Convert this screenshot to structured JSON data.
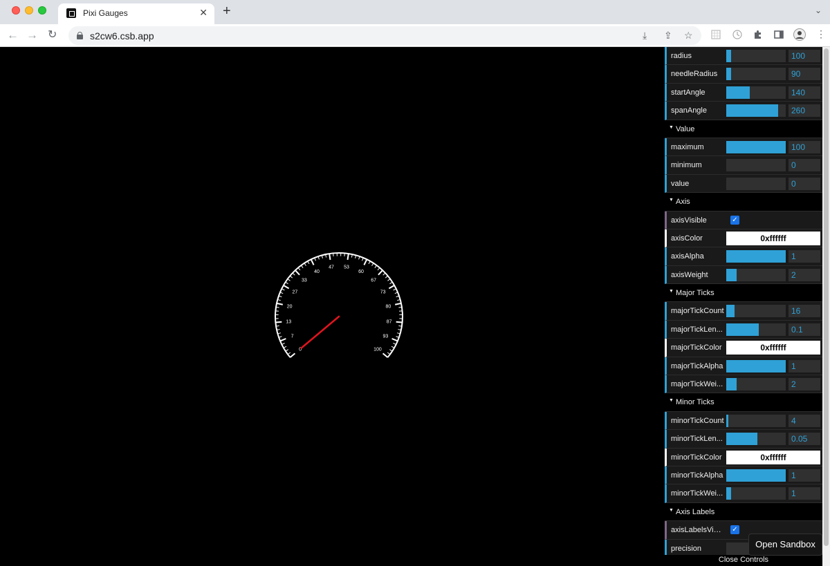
{
  "browser": {
    "tab_title": "Pixi Gauges",
    "new_tab": "+",
    "tab_close": "✕",
    "url": "s2cw6.csb.app"
  },
  "gauge": {
    "tick_labels": [
      "0",
      "7",
      "13",
      "20",
      "27",
      "33",
      "40",
      "47",
      "53",
      "60",
      "67",
      "73",
      "80",
      "87",
      "93",
      "100"
    ],
    "value": 0,
    "min": 0,
    "max": 100,
    "start_angle": 140,
    "span_angle": 260,
    "major_tick_count": 16,
    "minor_tick_count": 4,
    "axis_color": "#ffffff",
    "needle_color": "#e0141e"
  },
  "gui": {
    "top_rows": [
      {
        "label": "radius",
        "value": "100",
        "fill": 0.08
      },
      {
        "label": "needleRadius",
        "value": "90",
        "fill": 0.08
      },
      {
        "label": "startAngle",
        "value": "140",
        "fill": 0.39
      },
      {
        "label": "spanAngle",
        "value": "260",
        "fill": 0.87
      }
    ],
    "folders": {
      "value": {
        "title": "Value",
        "rows": [
          {
            "label": "maximum",
            "value": "100",
            "fill": 1.0
          },
          {
            "label": "minimum",
            "value": "0",
            "fill": 0.0
          },
          {
            "label": "value",
            "value": "0",
            "fill": 0.0
          }
        ]
      },
      "axis": {
        "title": "Axis",
        "visible_label": "axisVisible",
        "color_label": "axisColor",
        "color_value": "0xffffff",
        "rows": [
          {
            "label": "axisAlpha",
            "value": "1",
            "fill": 1.0
          },
          {
            "label": "axisWeight",
            "value": "2",
            "fill": 0.17
          }
        ]
      },
      "major": {
        "title": "Major Ticks",
        "rows_a": [
          {
            "label": "majorTickCount",
            "value": "16",
            "fill": 0.14
          },
          {
            "label": "majorTickLen...",
            "value": "0.1",
            "fill": 0.55
          }
        ],
        "color_label": "majorTickColor",
        "color_value": "0xffffff",
        "rows_b": [
          {
            "label": "majorTickAlpha",
            "value": "1",
            "fill": 1.0
          },
          {
            "label": "majorTickWei...",
            "value": "2",
            "fill": 0.17
          }
        ]
      },
      "minor": {
        "title": "Minor Ticks",
        "rows_a": [
          {
            "label": "minorTickCount",
            "value": "4",
            "fill": 0.03
          },
          {
            "label": "minorTickLen...",
            "value": "0.05",
            "fill": 0.52
          }
        ],
        "color_label": "minorTickColor",
        "color_value": "0xffffff",
        "rows_b": [
          {
            "label": "minorTickAlpha",
            "value": "1",
            "fill": 1.0
          },
          {
            "label": "minorTickWei...",
            "value": "1",
            "fill": 0.08
          }
        ]
      },
      "labels": {
        "title": "Axis Labels",
        "visible_label": "axisLabelsVisi...",
        "precision_label": "precision"
      }
    },
    "close_controls": "Close Controls"
  },
  "open_sandbox": "Open Sandbox",
  "colors": {
    "accent": "#2fa1d6",
    "bool_accent": "#806787"
  }
}
